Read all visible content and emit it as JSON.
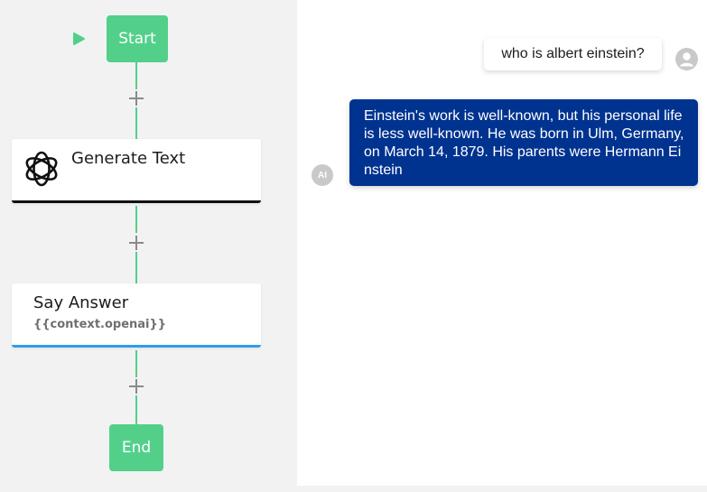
{
  "flow": {
    "start_label": "Start",
    "end_label": "End",
    "add_step_symbol": "+",
    "generate_text": {
      "title": "Generate Text",
      "icon": "openai-icon"
    },
    "say_answer": {
      "title": "Say Answer",
      "subtitle": "{{context.openai}}"
    }
  },
  "chat": {
    "user_message": "who is albert einstein?",
    "ai_avatar_label": "AI",
    "ai_message": "Einstein's work is well-known, but his personal life is less well-known. He was born in Ulm, Germany, on March 14, 1879. His parents were Hermann Einstein"
  },
  "colors": {
    "flow_green": "#52d08a",
    "ai_bubble_blue": "#003390",
    "say_answer_accent": "#2f9ee8",
    "generate_text_accent": "#111111",
    "canvas_bg": "#f2f2f2"
  }
}
